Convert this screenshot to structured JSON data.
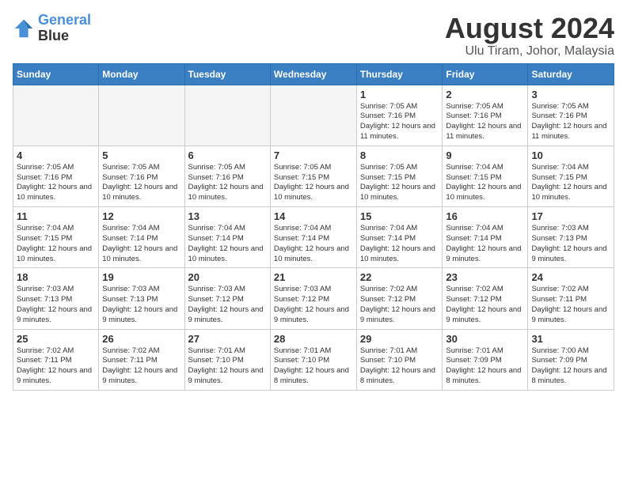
{
  "header": {
    "logo_line1": "General",
    "logo_line2": "Blue",
    "month": "August 2024",
    "location": "Ulu Tiram, Johor, Malaysia"
  },
  "weekdays": [
    "Sunday",
    "Monday",
    "Tuesday",
    "Wednesday",
    "Thursday",
    "Friday",
    "Saturday"
  ],
  "weeks": [
    [
      {
        "day": "",
        "info": ""
      },
      {
        "day": "",
        "info": ""
      },
      {
        "day": "",
        "info": ""
      },
      {
        "day": "",
        "info": ""
      },
      {
        "day": "1",
        "info": "Sunrise: 7:05 AM\nSunset: 7:16 PM\nDaylight: 12 hours\nand 11 minutes."
      },
      {
        "day": "2",
        "info": "Sunrise: 7:05 AM\nSunset: 7:16 PM\nDaylight: 12 hours\nand 11 minutes."
      },
      {
        "day": "3",
        "info": "Sunrise: 7:05 AM\nSunset: 7:16 PM\nDaylight: 12 hours\nand 11 minutes."
      }
    ],
    [
      {
        "day": "4",
        "info": "Sunrise: 7:05 AM\nSunset: 7:16 PM\nDaylight: 12 hours\nand 10 minutes."
      },
      {
        "day": "5",
        "info": "Sunrise: 7:05 AM\nSunset: 7:16 PM\nDaylight: 12 hours\nand 10 minutes."
      },
      {
        "day": "6",
        "info": "Sunrise: 7:05 AM\nSunset: 7:16 PM\nDaylight: 12 hours\nand 10 minutes."
      },
      {
        "day": "7",
        "info": "Sunrise: 7:05 AM\nSunset: 7:15 PM\nDaylight: 12 hours\nand 10 minutes."
      },
      {
        "day": "8",
        "info": "Sunrise: 7:05 AM\nSunset: 7:15 PM\nDaylight: 12 hours\nand 10 minutes."
      },
      {
        "day": "9",
        "info": "Sunrise: 7:04 AM\nSunset: 7:15 PM\nDaylight: 12 hours\nand 10 minutes."
      },
      {
        "day": "10",
        "info": "Sunrise: 7:04 AM\nSunset: 7:15 PM\nDaylight: 12 hours\nand 10 minutes."
      }
    ],
    [
      {
        "day": "11",
        "info": "Sunrise: 7:04 AM\nSunset: 7:15 PM\nDaylight: 12 hours\nand 10 minutes."
      },
      {
        "day": "12",
        "info": "Sunrise: 7:04 AM\nSunset: 7:14 PM\nDaylight: 12 hours\nand 10 minutes."
      },
      {
        "day": "13",
        "info": "Sunrise: 7:04 AM\nSunset: 7:14 PM\nDaylight: 12 hours\nand 10 minutes."
      },
      {
        "day": "14",
        "info": "Sunrise: 7:04 AM\nSunset: 7:14 PM\nDaylight: 12 hours\nand 10 minutes."
      },
      {
        "day": "15",
        "info": "Sunrise: 7:04 AM\nSunset: 7:14 PM\nDaylight: 12 hours\nand 10 minutes."
      },
      {
        "day": "16",
        "info": "Sunrise: 7:04 AM\nSunset: 7:14 PM\nDaylight: 12 hours\nand 9 minutes."
      },
      {
        "day": "17",
        "info": "Sunrise: 7:03 AM\nSunset: 7:13 PM\nDaylight: 12 hours\nand 9 minutes."
      }
    ],
    [
      {
        "day": "18",
        "info": "Sunrise: 7:03 AM\nSunset: 7:13 PM\nDaylight: 12 hours\nand 9 minutes."
      },
      {
        "day": "19",
        "info": "Sunrise: 7:03 AM\nSunset: 7:13 PM\nDaylight: 12 hours\nand 9 minutes."
      },
      {
        "day": "20",
        "info": "Sunrise: 7:03 AM\nSunset: 7:12 PM\nDaylight: 12 hours\nand 9 minutes."
      },
      {
        "day": "21",
        "info": "Sunrise: 7:03 AM\nSunset: 7:12 PM\nDaylight: 12 hours\nand 9 minutes."
      },
      {
        "day": "22",
        "info": "Sunrise: 7:02 AM\nSunset: 7:12 PM\nDaylight: 12 hours\nand 9 minutes."
      },
      {
        "day": "23",
        "info": "Sunrise: 7:02 AM\nSunset: 7:12 PM\nDaylight: 12 hours\nand 9 minutes."
      },
      {
        "day": "24",
        "info": "Sunrise: 7:02 AM\nSunset: 7:11 PM\nDaylight: 12 hours\nand 9 minutes."
      }
    ],
    [
      {
        "day": "25",
        "info": "Sunrise: 7:02 AM\nSunset: 7:11 PM\nDaylight: 12 hours\nand 9 minutes."
      },
      {
        "day": "26",
        "info": "Sunrise: 7:02 AM\nSunset: 7:11 PM\nDaylight: 12 hours\nand 9 minutes."
      },
      {
        "day": "27",
        "info": "Sunrise: 7:01 AM\nSunset: 7:10 PM\nDaylight: 12 hours\nand 9 minutes."
      },
      {
        "day": "28",
        "info": "Sunrise: 7:01 AM\nSunset: 7:10 PM\nDaylight: 12 hours\nand 8 minutes."
      },
      {
        "day": "29",
        "info": "Sunrise: 7:01 AM\nSunset: 7:10 PM\nDaylight: 12 hours\nand 8 minutes."
      },
      {
        "day": "30",
        "info": "Sunrise: 7:01 AM\nSunset: 7:09 PM\nDaylight: 12 hours\nand 8 minutes."
      },
      {
        "day": "31",
        "info": "Sunrise: 7:00 AM\nSunset: 7:09 PM\nDaylight: 12 hours\nand 8 minutes."
      }
    ]
  ]
}
